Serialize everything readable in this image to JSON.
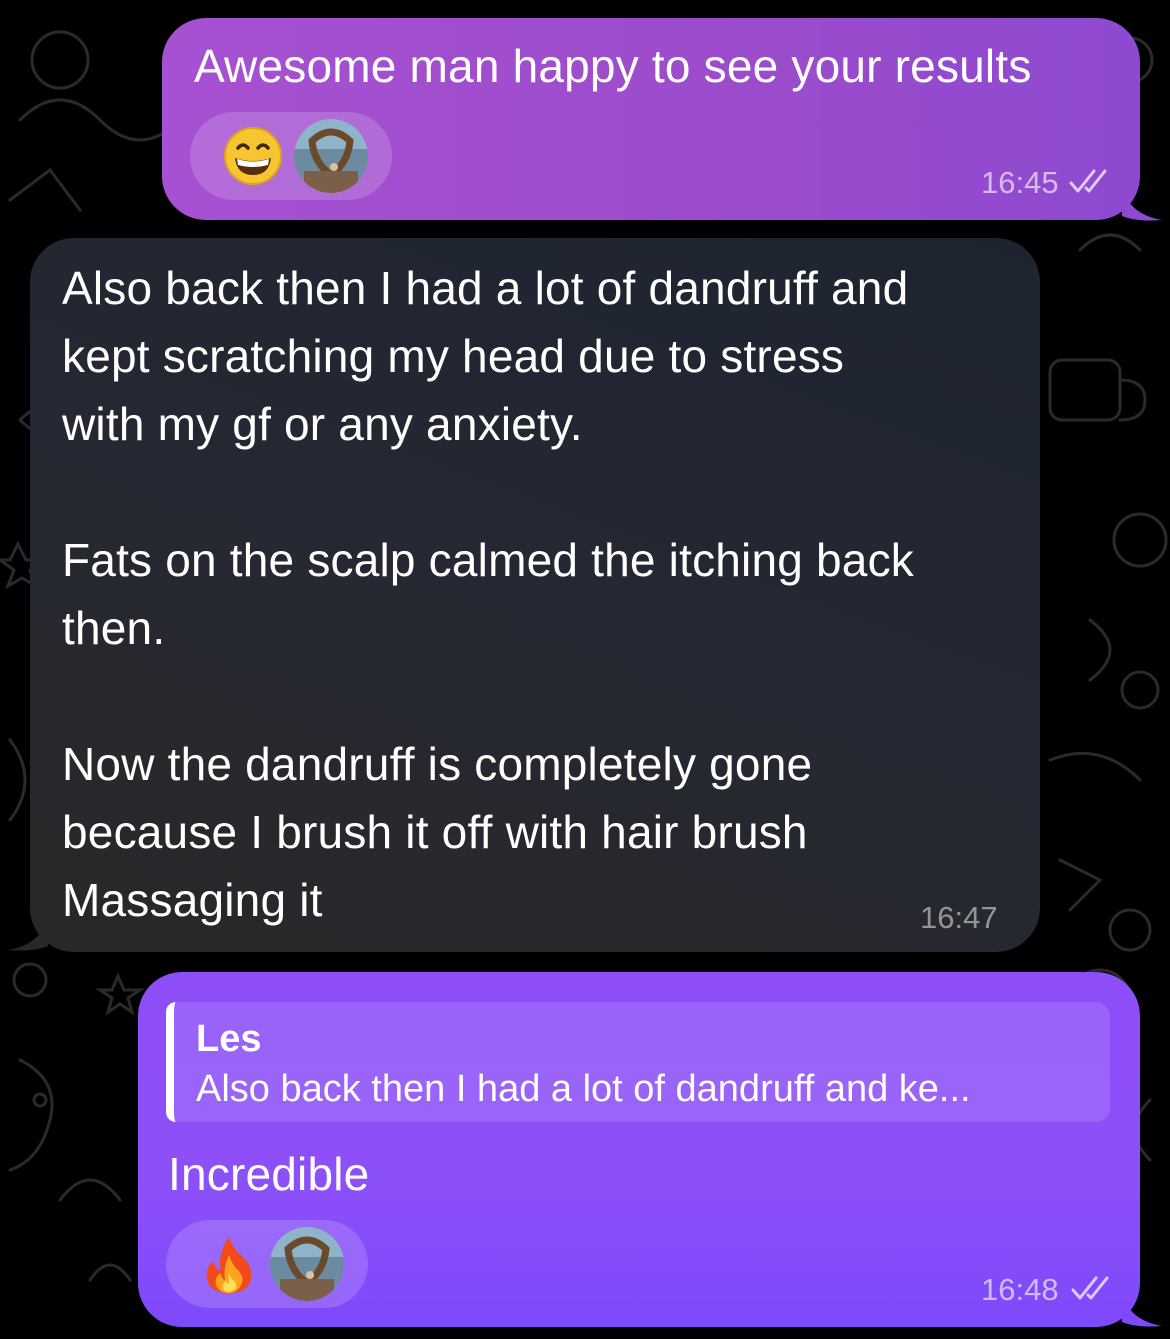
{
  "messages": [
    {
      "direction": "outgoing",
      "text": "Awesome man happy to see your results",
      "time": "16:45",
      "status": "read-double-check",
      "reactions": [
        {
          "emoji": "😁",
          "icon": "grinning-face-icon"
        },
        {
          "icon": "reactor-avatar"
        }
      ]
    },
    {
      "direction": "incoming",
      "lines": [
        "Also back then I had a lot of dandruff and",
        "kept scratching my head due to stress",
        "with my gf or any anxiety.",
        "",
        "Fats on the scalp calmed the itching back",
        "then.",
        "",
        "Now the dandruff is completely gone",
        "because I brush it off with hair brush",
        "Massaging it"
      ],
      "time": "16:47"
    },
    {
      "direction": "outgoing",
      "reply_to": {
        "name": "Les",
        "text": "Also back then I had a lot of dandruff and ke..."
      },
      "text": "Incredible",
      "time": "16:48",
      "status": "read-double-check",
      "reactions": [
        {
          "emoji": "🔥",
          "icon": "fire-icon"
        },
        {
          "icon": "reactor-avatar"
        }
      ]
    }
  ],
  "colors": {
    "outgoing_top": "#a651d2",
    "outgoing_bottom": "#7e49fb",
    "incoming": "#252833",
    "background": "#000000"
  }
}
